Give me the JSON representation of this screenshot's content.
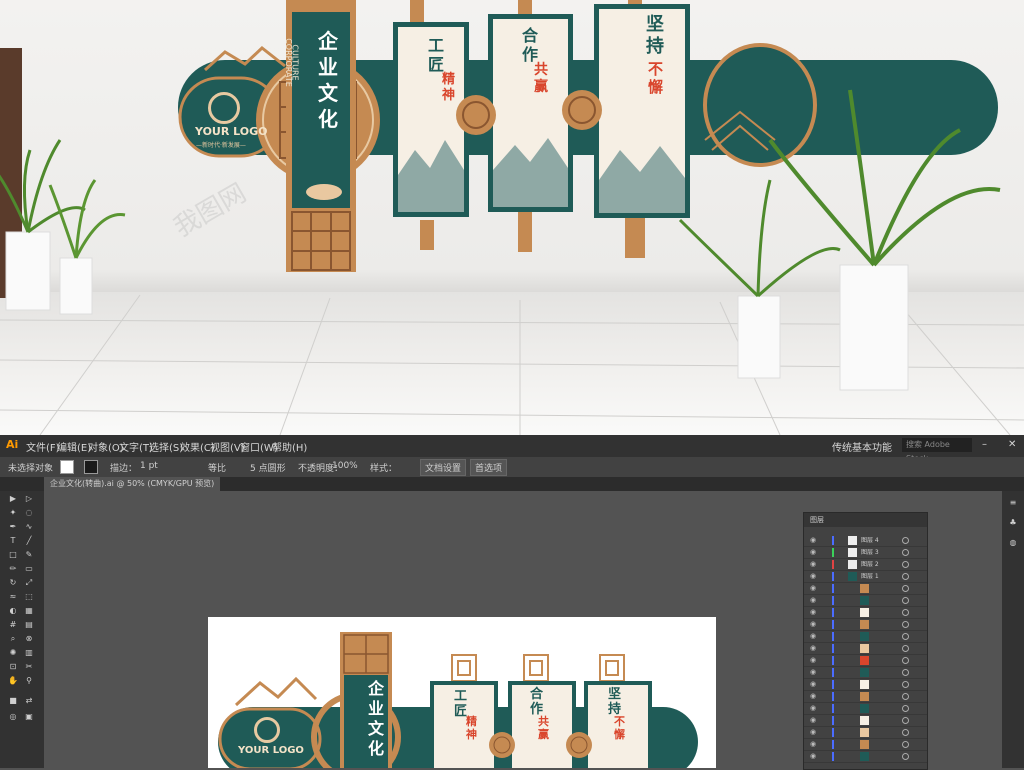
{
  "photo": {
    "panel_title": "企业文化",
    "panel_subtitle_1": "CORPORATE",
    "panel_subtitle_2": "CULTURE",
    "logo_text": "YOUR LOGO",
    "logo_slogan": "—新时代·新发展—",
    "board1_title": "工匠",
    "board1_accent": "精神",
    "board2_title": "合作",
    "board2_accent": "共赢",
    "board3_title": "坚持",
    "board3_accent": "不懈",
    "watermark": "我图网"
  },
  "app": {
    "logo": "Ai",
    "menus": [
      "文件(F)",
      "编辑(E)",
      "对象(O)",
      "文字(T)",
      "选择(S)",
      "效果(C)",
      "视图(V)",
      "窗口(W)",
      "帮助(H)"
    ],
    "workspace": "传统基本功能",
    "search_placeholder": "搜索 Adobe Stock"
  },
  "control": {
    "selection": "未选择对象",
    "stroke_label": "描边：",
    "stroke_value": "1 pt",
    "profile_label": "等比",
    "brush_label": "5 点圆形",
    "opacity_label": "不透明度：",
    "opacity_value": "100%",
    "style_label": "样式：",
    "doc_setup": "文档设置",
    "prefs": "首选项"
  },
  "document": {
    "tab": "企业文化(转曲).ai @ 50% (CMYK/GPU 预览)"
  },
  "layers": {
    "panel_title": "图层",
    "items": [
      "图层 4",
      "图层 3",
      "图层 2",
      "图层 1"
    ]
  },
  "colors": {
    "accent_green": "#1f5b57",
    "wood": "#c58a52",
    "red": "#d9452c",
    "ui_dark": "#323232"
  }
}
